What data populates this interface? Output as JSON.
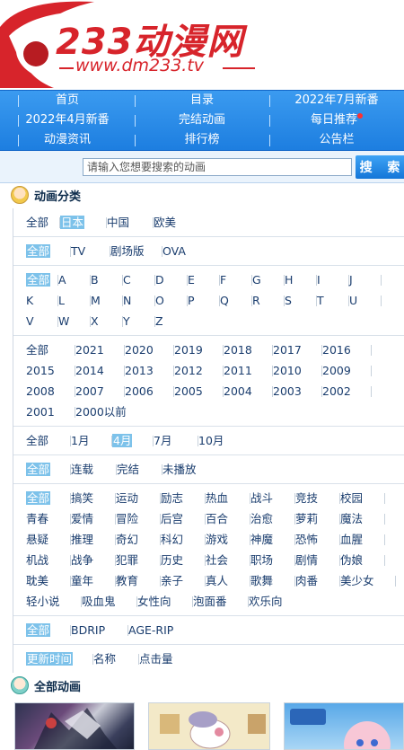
{
  "logo": {
    "title": "233动漫网",
    "url": "www.dm233.tv"
  },
  "nav": {
    "rows": [
      [
        "首页",
        "目录",
        "2022年7月新番"
      ],
      [
        "2022年4月新番",
        "完结动画",
        "每日推荐"
      ],
      [
        "动漫资讯",
        "排行榜",
        "公告栏"
      ]
    ]
  },
  "search": {
    "placeholder": "请输入您想要搜索的动画",
    "button": "搜 索"
  },
  "section_category": "动画分类",
  "section_all": "全部动画",
  "filters": {
    "region": [
      "全部",
      "日本",
      "中国",
      "欧美"
    ],
    "type": [
      "全部",
      "TV",
      "剧场版",
      "OVA"
    ],
    "letter": [
      "全部",
      "A",
      "B",
      "C",
      "D",
      "E",
      "F",
      "G",
      "H",
      "I",
      "J",
      "K",
      "L",
      "M",
      "N",
      "O",
      "P",
      "Q",
      "R",
      "S",
      "T",
      "U",
      "V",
      "W",
      "X",
      "Y",
      "Z"
    ],
    "year": [
      "全部",
      "2021",
      "2020",
      "2019",
      "2018",
      "2017",
      "2016",
      "2015",
      "2014",
      "2013",
      "2012",
      "2011",
      "2010",
      "2009",
      "2008",
      "2007",
      "2006",
      "2005",
      "2004",
      "2003",
      "2002",
      "2001",
      "2000以前"
    ],
    "month": [
      "全部",
      "1月",
      "4月",
      "7月",
      "10月"
    ],
    "status": [
      "全部",
      "连载",
      "完结",
      "未播放"
    ],
    "genre": [
      "全部",
      "搞笑",
      "运动",
      "励志",
      "热血",
      "战斗",
      "竞技",
      "校园",
      "青春",
      "爱情",
      "冒险",
      "后宫",
      "百合",
      "治愈",
      "萝莉",
      "魔法",
      "悬疑",
      "推理",
      "奇幻",
      "科幻",
      "游戏",
      "神魔",
      "恐怖",
      "血腥",
      "机战",
      "战争",
      "犯罪",
      "历史",
      "社会",
      "职场",
      "剧情",
      "伪娘",
      "耽美",
      "童年",
      "教育",
      "亲子",
      "真人",
      "歌舞",
      "肉番",
      "美少女",
      "轻小说",
      "吸血鬼",
      "女性向",
      "泡面番",
      "欢乐向"
    ],
    "resource": [
      "全部",
      "BDRIP",
      "AGE-RIP"
    ],
    "sort": [
      "更新时间",
      "名称",
      "点击量"
    ]
  },
  "selected": {
    "region": 1,
    "type": 0,
    "letter": 0,
    "year": null,
    "month": 2,
    "status": 0,
    "genre": 0,
    "resource": 0,
    "sort": 0
  },
  "colors": {
    "accent": "#d7242b",
    "nav": "#2a8ce8",
    "selected_bg": "#7dc2ea"
  }
}
